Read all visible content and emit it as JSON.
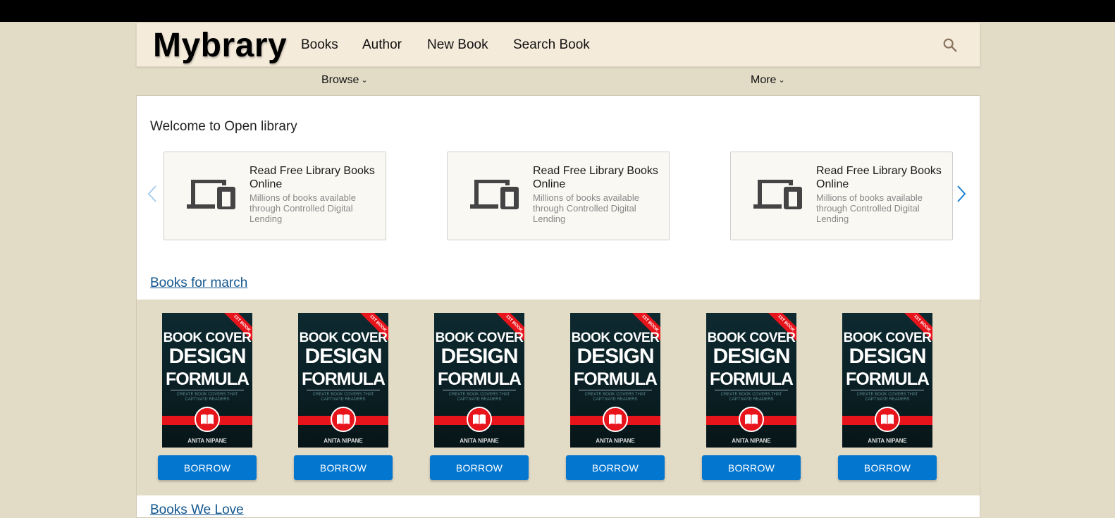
{
  "header": {
    "logo": "Mybrary",
    "nav": [
      "Books",
      "Author",
      "New Book",
      "Search Book"
    ],
    "search_icon": "search-icon"
  },
  "subnav": {
    "browse": "Browse",
    "more": "More"
  },
  "main": {
    "welcome": "Welcome to Open library",
    "promo_cards": [
      {
        "title": "Read Free Library Books Online",
        "desc": "Millions of books available through Controlled Digital Lending",
        "icon": "devices-icon"
      },
      {
        "title": "Read Free Library Books Online",
        "desc": "Millions of books available through Controlled Digital Lending",
        "icon": "devices-icon"
      },
      {
        "title": "Read Free Library Books Online",
        "desc": "Millions of books available through Controlled Digital Lending",
        "icon": "devices-icon"
      }
    ],
    "books_section_title": "Books for march",
    "books": [
      {
        "cover": {
          "ribbon": "1ST BOOK",
          "line1": "BOOK COVER",
          "line2": "DESIGN",
          "line3": "FORMULA",
          "tagline": "CREATE BOOK COVERS THAT CAPTIVATE READERS",
          "author": "ANITA NIPANE"
        },
        "button": "BORROW"
      },
      {
        "cover": {
          "ribbon": "1ST BOOK",
          "line1": "BOOK COVER",
          "line2": "DESIGN",
          "line3": "FORMULA",
          "tagline": "CREATE BOOK COVERS THAT CAPTIVATE READERS",
          "author": "ANITA NIPANE"
        },
        "button": "BORROW"
      },
      {
        "cover": {
          "ribbon": "1ST BOOK",
          "line1": "BOOK COVER",
          "line2": "DESIGN",
          "line3": "FORMULA",
          "tagline": "CREATE BOOK COVERS THAT CAPTIVATE READERS",
          "author": "ANITA NIPANE"
        },
        "button": "BORROW"
      },
      {
        "cover": {
          "ribbon": "1ST BOOK",
          "line1": "BOOK COVER",
          "line2": "DESIGN",
          "line3": "FORMULA",
          "tagline": "CREATE BOOK COVERS THAT CAPTIVATE READERS",
          "author": "ANITA NIPANE"
        },
        "button": "BORROW"
      },
      {
        "cover": {
          "ribbon": "1ST BOOK",
          "line1": "BOOK COVER",
          "line2": "DESIGN",
          "line3": "FORMULA",
          "tagline": "CREATE BOOK COVERS THAT CAPTIVATE READERS",
          "author": "ANITA NIPANE"
        },
        "button": "BORROW"
      },
      {
        "cover": {
          "ribbon": "1ST BOOK",
          "line1": "BOOK COVER",
          "line2": "DESIGN",
          "line3": "FORMULA",
          "tagline": "CREATE BOOK COVERS THAT CAPTIVATE READERS",
          "author": "ANITA NIPANE"
        },
        "button": "BORROW"
      }
    ],
    "next_section_title": "Books We Love"
  },
  "colors": {
    "page_bg": "#e2dbc6",
    "header_bg": "#f5ebdb",
    "link": "#13578f",
    "button": "#0376d0",
    "arrow": "#1b7fd4",
    "cover_red": "#e8141c"
  }
}
